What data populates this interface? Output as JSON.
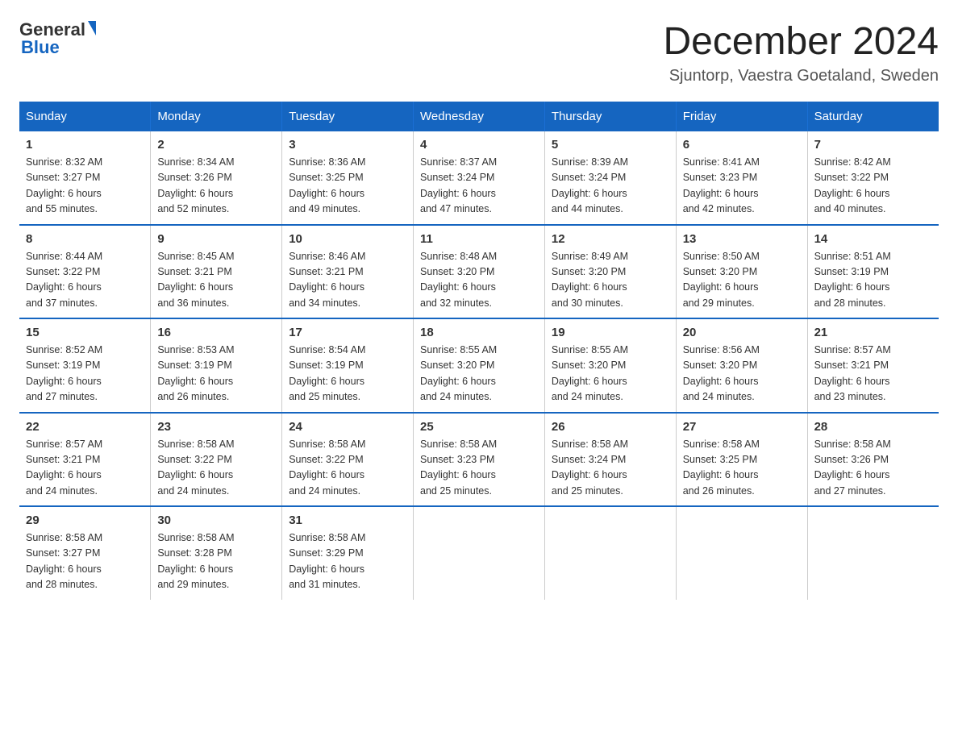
{
  "header": {
    "logo_general": "General",
    "logo_blue": "Blue",
    "month_title": "December 2024",
    "location": "Sjuntorp, Vaestra Goetaland, Sweden"
  },
  "weekdays": [
    "Sunday",
    "Monday",
    "Tuesday",
    "Wednesday",
    "Thursday",
    "Friday",
    "Saturday"
  ],
  "weeks": [
    [
      {
        "day": "1",
        "sunrise": "8:32 AM",
        "sunset": "3:27 PM",
        "daylight": "6 hours and 55 minutes."
      },
      {
        "day": "2",
        "sunrise": "8:34 AM",
        "sunset": "3:26 PM",
        "daylight": "6 hours and 52 minutes."
      },
      {
        "day": "3",
        "sunrise": "8:36 AM",
        "sunset": "3:25 PM",
        "daylight": "6 hours and 49 minutes."
      },
      {
        "day": "4",
        "sunrise": "8:37 AM",
        "sunset": "3:24 PM",
        "daylight": "6 hours and 47 minutes."
      },
      {
        "day": "5",
        "sunrise": "8:39 AM",
        "sunset": "3:24 PM",
        "daylight": "6 hours and 44 minutes."
      },
      {
        "day": "6",
        "sunrise": "8:41 AM",
        "sunset": "3:23 PM",
        "daylight": "6 hours and 42 minutes."
      },
      {
        "day": "7",
        "sunrise": "8:42 AM",
        "sunset": "3:22 PM",
        "daylight": "6 hours and 40 minutes."
      }
    ],
    [
      {
        "day": "8",
        "sunrise": "8:44 AM",
        "sunset": "3:22 PM",
        "daylight": "6 hours and 37 minutes."
      },
      {
        "day": "9",
        "sunrise": "8:45 AM",
        "sunset": "3:21 PM",
        "daylight": "6 hours and 36 minutes."
      },
      {
        "day": "10",
        "sunrise": "8:46 AM",
        "sunset": "3:21 PM",
        "daylight": "6 hours and 34 minutes."
      },
      {
        "day": "11",
        "sunrise": "8:48 AM",
        "sunset": "3:20 PM",
        "daylight": "6 hours and 32 minutes."
      },
      {
        "day": "12",
        "sunrise": "8:49 AM",
        "sunset": "3:20 PM",
        "daylight": "6 hours and 30 minutes."
      },
      {
        "day": "13",
        "sunrise": "8:50 AM",
        "sunset": "3:20 PM",
        "daylight": "6 hours and 29 minutes."
      },
      {
        "day": "14",
        "sunrise": "8:51 AM",
        "sunset": "3:19 PM",
        "daylight": "6 hours and 28 minutes."
      }
    ],
    [
      {
        "day": "15",
        "sunrise": "8:52 AM",
        "sunset": "3:19 PM",
        "daylight": "6 hours and 27 minutes."
      },
      {
        "day": "16",
        "sunrise": "8:53 AM",
        "sunset": "3:19 PM",
        "daylight": "6 hours and 26 minutes."
      },
      {
        "day": "17",
        "sunrise": "8:54 AM",
        "sunset": "3:19 PM",
        "daylight": "6 hours and 25 minutes."
      },
      {
        "day": "18",
        "sunrise": "8:55 AM",
        "sunset": "3:20 PM",
        "daylight": "6 hours and 24 minutes."
      },
      {
        "day": "19",
        "sunrise": "8:55 AM",
        "sunset": "3:20 PM",
        "daylight": "6 hours and 24 minutes."
      },
      {
        "day": "20",
        "sunrise": "8:56 AM",
        "sunset": "3:20 PM",
        "daylight": "6 hours and 24 minutes."
      },
      {
        "day": "21",
        "sunrise": "8:57 AM",
        "sunset": "3:21 PM",
        "daylight": "6 hours and 23 minutes."
      }
    ],
    [
      {
        "day": "22",
        "sunrise": "8:57 AM",
        "sunset": "3:21 PM",
        "daylight": "6 hours and 24 minutes."
      },
      {
        "day": "23",
        "sunrise": "8:58 AM",
        "sunset": "3:22 PM",
        "daylight": "6 hours and 24 minutes."
      },
      {
        "day": "24",
        "sunrise": "8:58 AM",
        "sunset": "3:22 PM",
        "daylight": "6 hours and 24 minutes."
      },
      {
        "day": "25",
        "sunrise": "8:58 AM",
        "sunset": "3:23 PM",
        "daylight": "6 hours and 25 minutes."
      },
      {
        "day": "26",
        "sunrise": "8:58 AM",
        "sunset": "3:24 PM",
        "daylight": "6 hours and 25 minutes."
      },
      {
        "day": "27",
        "sunrise": "8:58 AM",
        "sunset": "3:25 PM",
        "daylight": "6 hours and 26 minutes."
      },
      {
        "day": "28",
        "sunrise": "8:58 AM",
        "sunset": "3:26 PM",
        "daylight": "6 hours and 27 minutes."
      }
    ],
    [
      {
        "day": "29",
        "sunrise": "8:58 AM",
        "sunset": "3:27 PM",
        "daylight": "6 hours and 28 minutes."
      },
      {
        "day": "30",
        "sunrise": "8:58 AM",
        "sunset": "3:28 PM",
        "daylight": "6 hours and 29 minutes."
      },
      {
        "day": "31",
        "sunrise": "8:58 AM",
        "sunset": "3:29 PM",
        "daylight": "6 hours and 31 minutes."
      },
      null,
      null,
      null,
      null
    ]
  ],
  "labels": {
    "sunrise": "Sunrise:",
    "sunset": "Sunset:",
    "daylight": "Daylight:"
  }
}
